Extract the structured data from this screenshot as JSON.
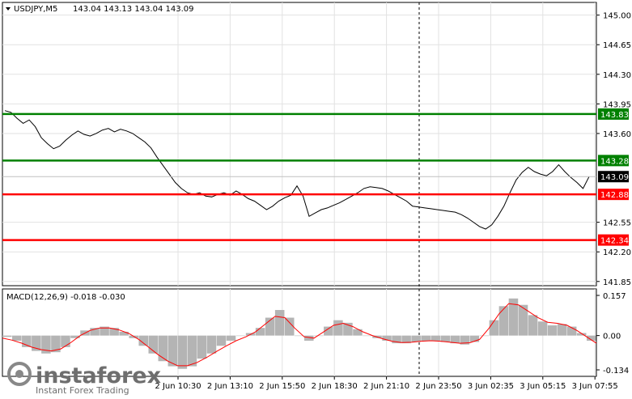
{
  "chart_data": [
    {
      "type": "line",
      "title": "USDJPY,M5",
      "ohlc": "143.04 143.13 143.04 143.09",
      "ylim": [
        141.8,
        145.15
      ],
      "y_ticks": [
        "145.00",
        "144.65",
        "144.30",
        "143.95",
        "143.60",
        "142.55",
        "142.20",
        "141.85"
      ],
      "grid": true,
      "x_labels": [
        "2 Jun 10:30",
        "2 Jun 13:10",
        "2 Jun 15:50",
        "2 Jun 18:30",
        "2 Jun 21:10",
        "2 Jun 23:50",
        "3 Jun 02:35",
        "3 Jun 05:15",
        "3 Jun 07:55"
      ],
      "price": [
        143.87,
        143.85,
        143.78,
        143.72,
        143.76,
        143.68,
        143.55,
        143.48,
        143.42,
        143.45,
        143.52,
        143.58,
        143.63,
        143.59,
        143.57,
        143.6,
        143.64,
        143.66,
        143.62,
        143.65,
        143.63,
        143.6,
        143.55,
        143.5,
        143.43,
        143.32,
        143.22,
        143.12,
        143.02,
        142.95,
        142.9,
        142.88,
        142.9,
        142.86,
        142.85,
        142.88,
        142.9,
        142.87,
        142.92,
        142.88,
        142.83,
        142.8,
        142.75,
        142.7,
        142.74,
        142.8,
        142.84,
        142.87,
        142.98,
        142.86,
        142.62,
        142.66,
        142.7,
        142.72,
        142.75,
        142.78,
        142.82,
        142.86,
        142.9,
        142.95,
        142.97,
        142.96,
        142.95,
        142.92,
        142.88,
        142.84,
        142.8,
        142.74,
        142.73,
        142.72,
        142.71,
        142.7,
        142.69,
        142.68,
        142.67,
        142.64,
        142.6,
        142.55,
        142.5,
        142.47,
        142.52,
        142.62,
        142.74,
        142.9,
        143.05,
        143.14,
        143.2,
        143.15,
        143.12,
        143.1,
        143.15,
        143.23,
        143.15,
        143.08,
        143.02,
        142.95,
        143.09
      ],
      "levels": [
        {
          "value": 143.83,
          "label": "143.83",
          "color": "#008000"
        },
        {
          "value": 143.28,
          "label": "143.28",
          "color": "#008000"
        },
        {
          "value": 142.88,
          "label": "142.88",
          "color": "#ff0000"
        },
        {
          "value": 142.34,
          "label": "142.34",
          "color": "#ff0000"
        }
      ],
      "current": {
        "value": 143.09,
        "label": "143.09"
      }
    },
    {
      "type": "bar",
      "title": "MACD(12,26,9) -0.018 -0.030",
      "ylim": [
        -0.134,
        0.157
      ],
      "y_ticks": [
        "0.157",
        "0.00",
        "-0.134"
      ],
      "histogram": [
        -0.005,
        -0.02,
        -0.045,
        -0.06,
        -0.07,
        -0.065,
        -0.045,
        -0.01,
        0.02,
        0.03,
        0.035,
        0.03,
        0.015,
        -0.01,
        -0.04,
        -0.07,
        -0.1,
        -0.12,
        -0.13,
        -0.12,
        -0.09,
        -0.07,
        -0.04,
        -0.02,
        0.0,
        0.01,
        0.03,
        0.07,
        0.1,
        0.07,
        0.0,
        -0.02,
        0.0,
        0.035,
        0.06,
        0.05,
        0.025,
        0.0,
        -0.01,
        -0.02,
        -0.03,
        -0.03,
        -0.025,
        -0.02,
        -0.02,
        -0.025,
        -0.03,
        -0.035,
        -0.025,
        0.0,
        0.06,
        0.115,
        0.145,
        0.12,
        0.08,
        0.055,
        0.04,
        0.045,
        0.035,
        0.01,
        -0.02
      ],
      "signal": [
        -0.01,
        -0.018,
        -0.03,
        -0.045,
        -0.055,
        -0.06,
        -0.052,
        -0.028,
        0.0,
        0.02,
        0.03,
        0.03,
        0.022,
        0.008,
        -0.015,
        -0.045,
        -0.075,
        -0.1,
        -0.118,
        -0.118,
        -0.105,
        -0.085,
        -0.062,
        -0.04,
        -0.02,
        -0.005,
        0.015,
        0.045,
        0.075,
        0.07,
        0.03,
        -0.005,
        -0.01,
        0.015,
        0.04,
        0.048,
        0.035,
        0.015,
        0.0,
        -0.012,
        -0.022,
        -0.027,
        -0.026,
        -0.022,
        -0.02,
        -0.022,
        -0.026,
        -0.03,
        -0.028,
        -0.015,
        0.03,
        0.085,
        0.125,
        0.12,
        0.095,
        0.07,
        0.052,
        0.048,
        0.04,
        0.02,
        -0.005,
        -0.03
      ]
    }
  ],
  "watermark": {
    "brand": "instaforex",
    "tagline": "Instant Forex Trading"
  },
  "colors": {
    "accent_green": "#008000",
    "accent_red": "#ff0000",
    "histogram": "#b4b4b4",
    "price_line": "#000000",
    "axis": "#000000"
  },
  "icons": {
    "menu": "triangle-down-icon"
  }
}
